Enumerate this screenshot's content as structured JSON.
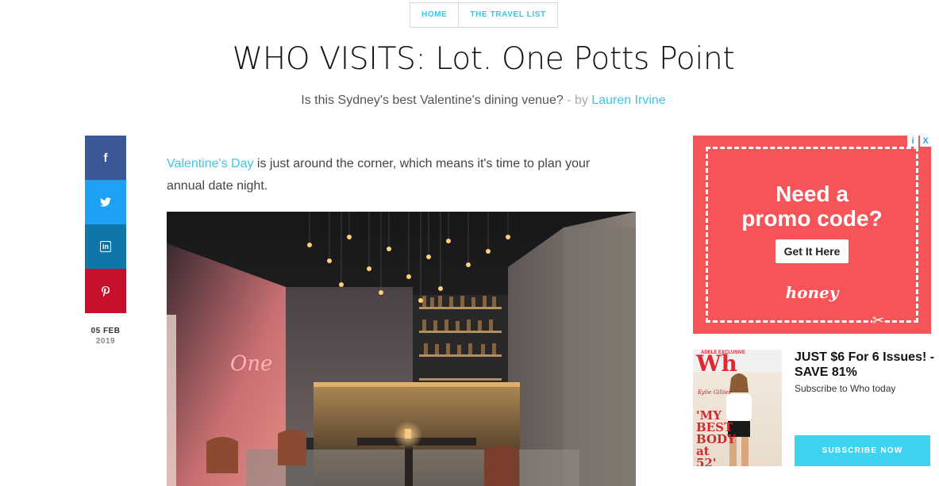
{
  "breadcrumb": [
    {
      "label": "HOME"
    },
    {
      "label": "THE TRAVEL LIST"
    }
  ],
  "article": {
    "title": "WHO VISITS: Lot. One Potts Point",
    "subtitle": "Is this Sydney's best Valentine's dining venue?",
    "by_text": "- by",
    "author": "Lauren Irvine",
    "intro_link": "Valentine's Day",
    "intro_rest": " is just around the corner, which means it's time to plan your annual date night.",
    "photo_neon_sign": "One"
  },
  "share": {
    "facebook": "f",
    "twitter": "twitter-icon",
    "linkedin": "in",
    "pinterest": "pinterest-icon",
    "date_day": "05 FEB",
    "date_year": "2019"
  },
  "ad": {
    "headline_line1": "Need a",
    "headline_line2": "promo code?",
    "cta": "Get It Here",
    "brand": "honey",
    "background": "#f65458",
    "choices": [
      "i",
      "X"
    ]
  },
  "subscribe": {
    "cover_logo": "Wh",
    "cover_exclusive": "ADELE EXCLUSIVE",
    "cover_name": "Kylie Gillies",
    "cover_headline": "'MY BEST BODY at 52'",
    "headline": "JUST $6 For 6 Issues! - SAVE 81%",
    "text": "Subscribe to Who today",
    "button": "SUBSCRIBE NOW"
  },
  "colors": {
    "accent": "#3cc6e6",
    "facebook": "#3b5998",
    "twitter": "#1da1f2",
    "linkedin": "#0e76a8",
    "pinterest": "#c8102e",
    "subscribe_button": "#3ed3f0"
  }
}
